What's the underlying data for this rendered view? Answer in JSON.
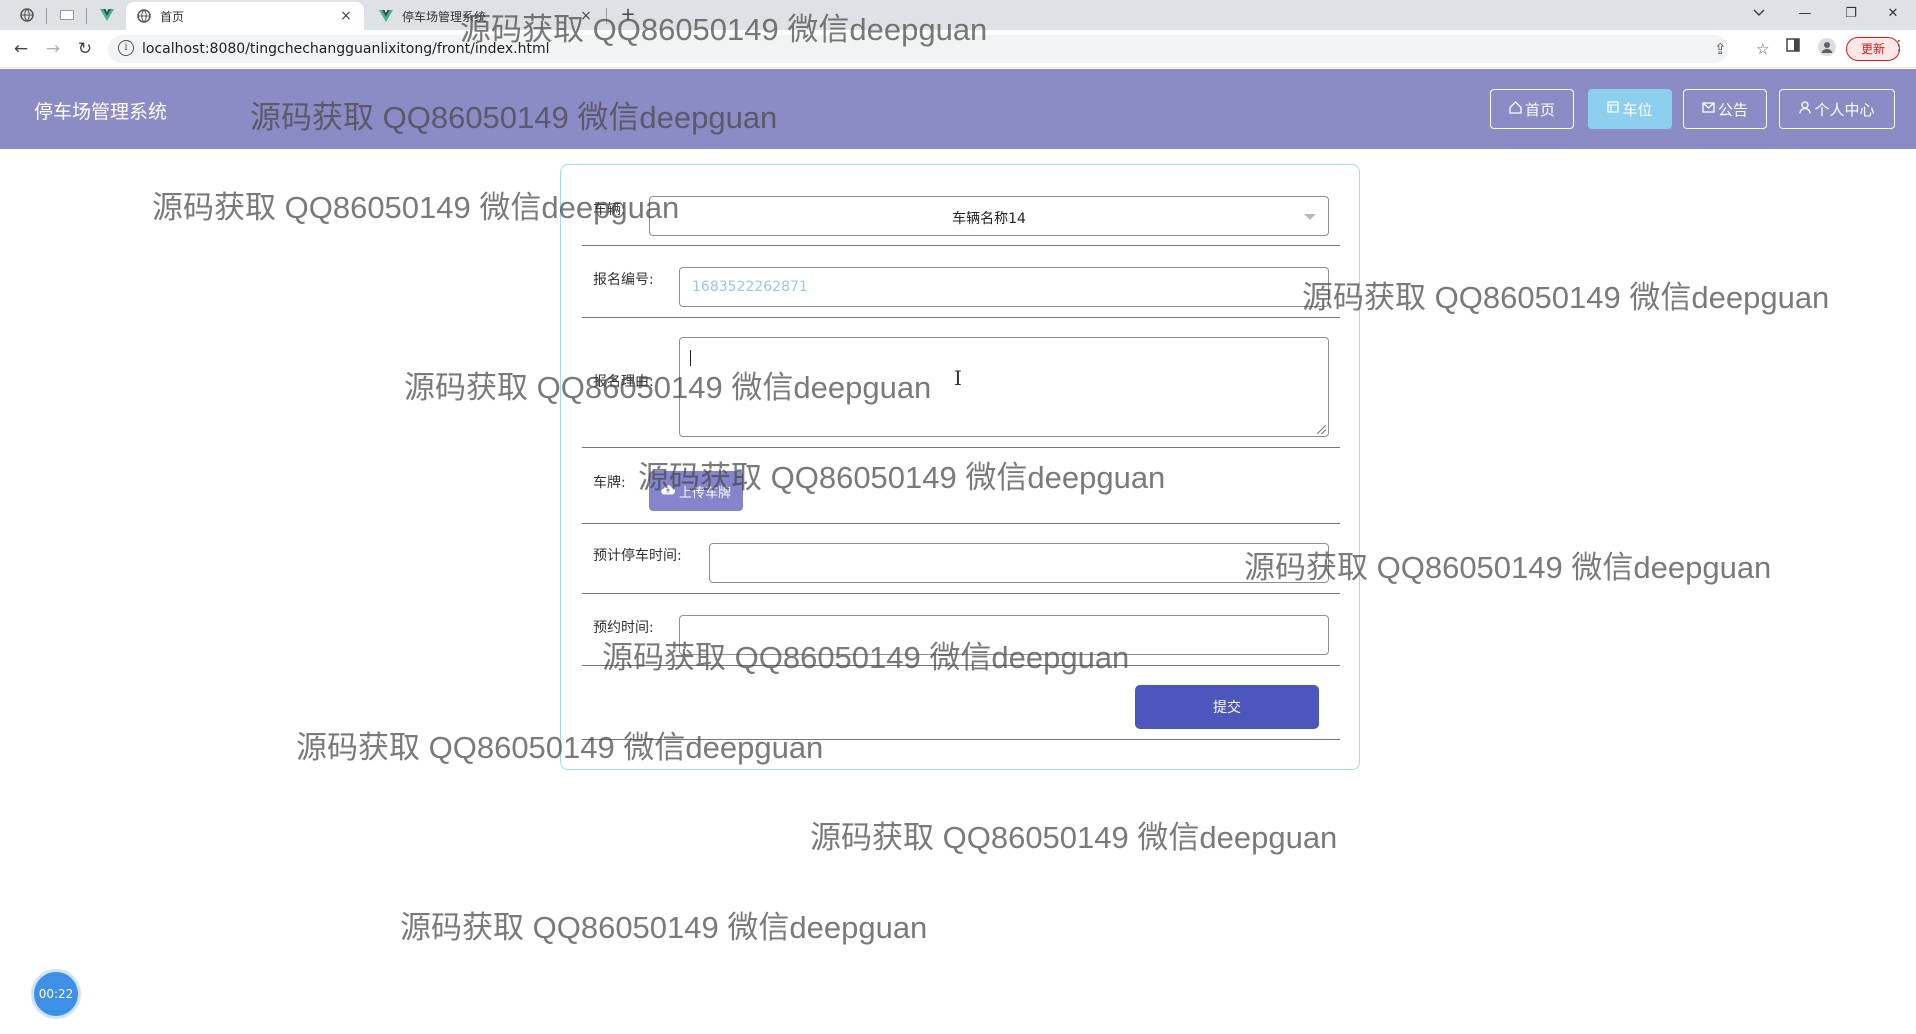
{
  "browser": {
    "tabs": [
      {
        "title": "首页",
        "close": "×"
      },
      {
        "title": "停车场管理系统",
        "close": "×"
      }
    ],
    "new_tab": "+",
    "url": "localhost:8080/tingchechangguanlixitong/front/index.html",
    "update_label": "更新",
    "window_controls": {
      "minimize": "—",
      "restore": "❐",
      "close": "✕"
    }
  },
  "header": {
    "title": "停车场管理系统",
    "nav": [
      {
        "label": "首页",
        "icon": "home-icon"
      },
      {
        "label": "车位",
        "icon": "parking-icon",
        "active": true
      },
      {
        "label": "公告",
        "icon": "mail-icon"
      },
      {
        "label": "个人中心",
        "icon": "user-icon"
      }
    ],
    "background_color": "#8b8bc6",
    "active_color": "#8ccfee"
  },
  "form": {
    "vehicle_label": "车辆:",
    "vehicle_value": "车辆名称14",
    "signup_no_label": "报名编号:",
    "signup_no_value": "1683522262871",
    "reason_label": "报名理由:",
    "reason_value": "",
    "plate_label": "车牌:",
    "upload_label": "上传车牌",
    "duration_label": "预计停车时间:",
    "duration_value": "",
    "booking_time_label": "预约时间:",
    "booking_time_value": "",
    "submit_label": "提交",
    "submit_color": "#4d56bc"
  },
  "timer": "00:22",
  "watermark": "源码获取 QQ86050149 微信deepguan"
}
